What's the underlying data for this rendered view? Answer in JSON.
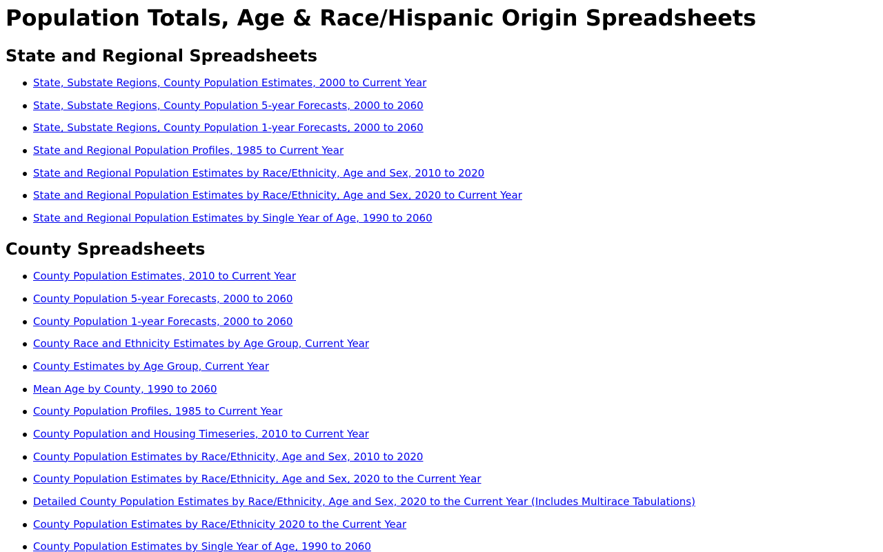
{
  "title": "Population Totals, Age & Race/Hispanic Origin Spreadsheets",
  "sections": [
    {
      "heading": "State and Regional Spreadsheets",
      "links": [
        "State, Substate Regions, County Population Estimates, 2000 to Current Year",
        "State, Substate Regions, County Population 5-year Forecasts, 2000 to 2060",
        "State, Substate Regions, County Population 1-year Forecasts, 2000 to 2060",
        "State and Regional Population Profiles, 1985 to Current Year",
        "State and Regional Population Estimates by Race/Ethnicity, Age and Sex, 2010 to 2020",
        "State and Regional Population Estimates by Race/Ethnicity, Age and Sex, 2020 to Current Year",
        "State and Regional Population Estimates by Single Year of Age, 1990 to 2060"
      ]
    },
    {
      "heading": "County Spreadsheets",
      "links": [
        "County Population Estimates, 2010 to Current Year",
        "County Population 5-year Forecasts, 2000 to 2060",
        "County Population 1-year Forecasts, 2000 to 2060",
        "County Race and Ethnicity Estimates by Age Group, Current Year",
        "County Estimates by Age Group, Current Year",
        "Mean Age by County, 1990 to 2060",
        "County Population Profiles, 1985 to Current Year",
        "County Population and Housing Timeseries, 2010 to Current Year",
        "County Population Estimates by Race/Ethnicity, Age and Sex, 2010 to 2020",
        "County Population Estimates by Race/Ethnicity, Age and Sex, 2020 to the Current Year",
        "Detailed County Population Estimates by Race/Ethnicity, Age and Sex, 2020 to the Current Year (Includes Multirace Tabulations)",
        "County Population Estimates by Race/Ethnicity 2020 to the Current Year",
        "County Population Estimates by Single Year of Age, 1990 to 2060"
      ]
    }
  ],
  "colors": {
    "link": "#0000ee",
    "text": "#000000",
    "background": "#ffffff"
  }
}
